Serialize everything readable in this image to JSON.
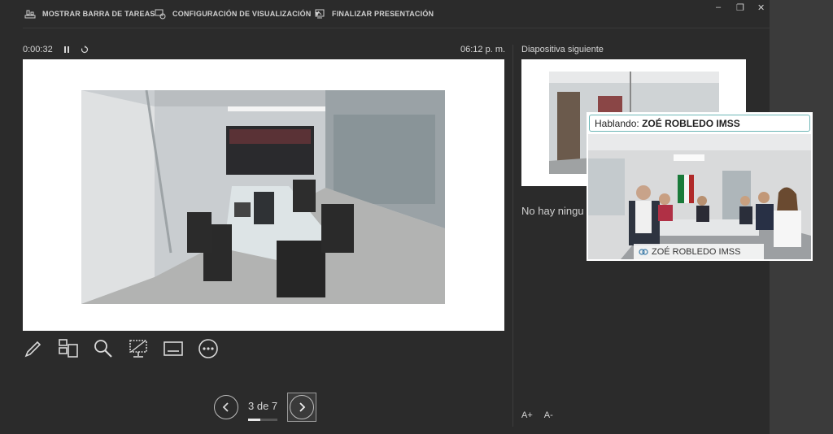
{
  "toolbar": {
    "show_taskbar": "MOSTRAR BARRA DE TAREAS",
    "display_settings": "CONFIGURACIÓN DE VISUALIZACIÓN ▼",
    "end_show": "FINALIZAR PRESENTACIÓN",
    "minimize": "–",
    "restore": "❐",
    "close": "✕"
  },
  "timer": {
    "elapsed": "0:00:32",
    "pause_icon": "pause-icon",
    "reset_icon": "restart-icon"
  },
  "clock": "06:12 p. m.",
  "next_slide": {
    "label": "Diapositiva siguiente"
  },
  "notes": {
    "text": "No hay ningu"
  },
  "tools": [
    "pen-icon",
    "slides-grid-icon",
    "zoom-icon",
    "black-screen-icon",
    "subtitles-icon",
    "more-icon"
  ],
  "nav": {
    "page_text": "3 de 7",
    "progress": 0.43
  },
  "font_controls": {
    "increase": "A+",
    "decrease": "A-"
  },
  "video": {
    "speaking_prefix": "Hablando:",
    "speaking_name": "ZOÉ ROBLEDO IMSS",
    "participant_name": "ZOÉ ROBLEDO IMSS"
  }
}
